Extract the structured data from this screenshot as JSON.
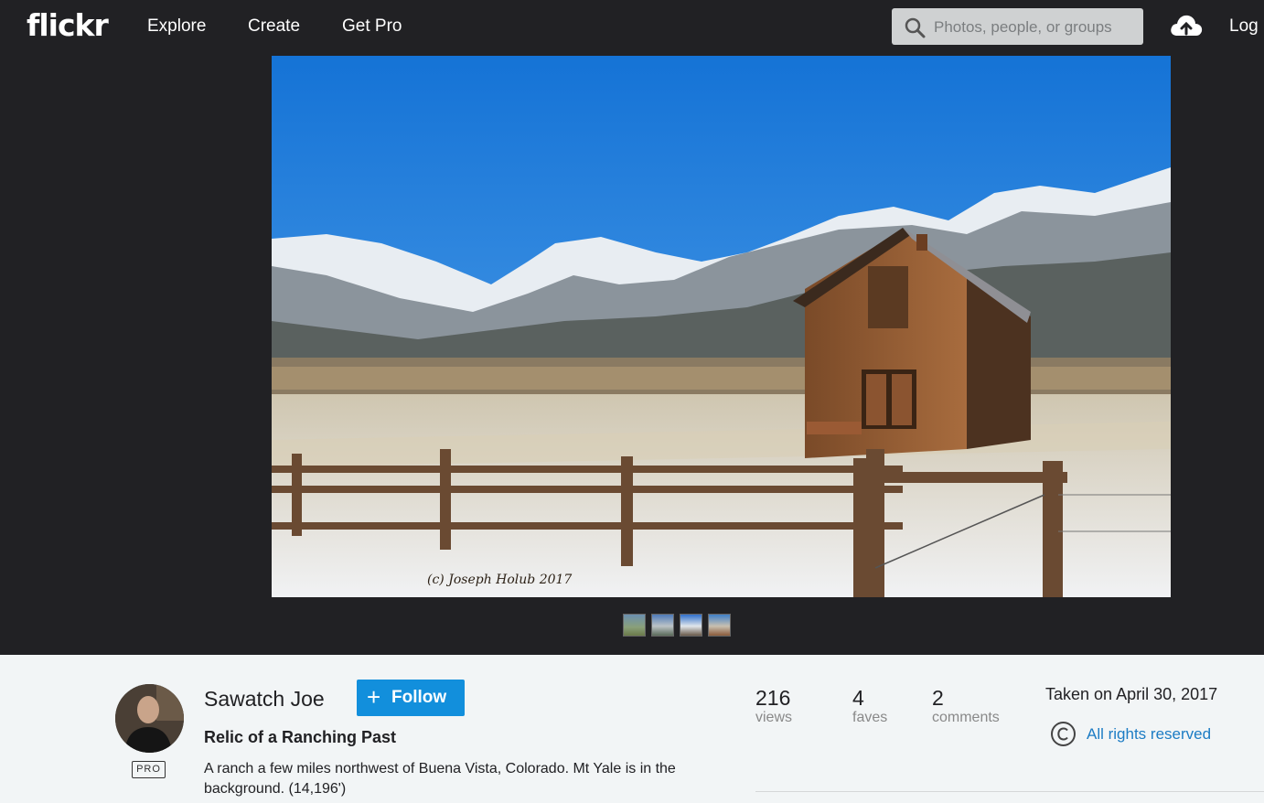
{
  "nav": {
    "logo": "flickr",
    "links": [
      "Explore",
      "Create",
      "Get Pro"
    ],
    "search_placeholder": "Photos, people, or groups",
    "login_label": "Log"
  },
  "photo": {
    "watermark": "(c) Joseph Holub 2017",
    "thumbnail_count": 4
  },
  "info": {
    "author": "Sawatch Joe",
    "pro_badge": "PRO",
    "follow_label": "Follow",
    "title": "Relic of a Ranching Past",
    "description": "A ranch a few miles northwest of Buena Vista, Colorado. Mt Yale is in the background. (14,196')",
    "stats": {
      "views": {
        "value": "216",
        "label": "views"
      },
      "faves": {
        "value": "4",
        "label": "faves"
      },
      "comments": {
        "value": "2",
        "label": "comments"
      }
    },
    "taken": "Taken on April 30, 2017",
    "license": "All rights reserved"
  },
  "colors": {
    "nav_bg": "#212124",
    "follow_blue": "#128fdc",
    "link_blue": "#1c7cc4"
  },
  "icons": [
    "search-icon",
    "upload-cloud-icon",
    "plus-icon",
    "copyright-icon"
  ]
}
